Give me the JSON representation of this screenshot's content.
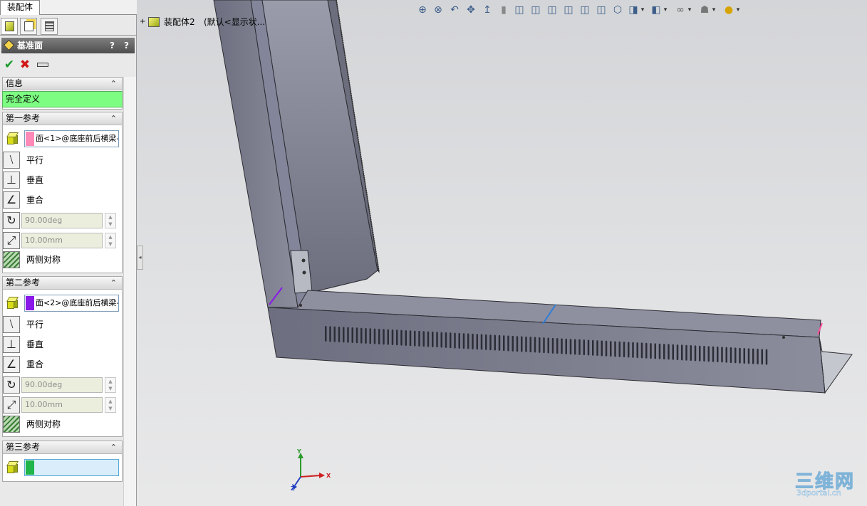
{
  "document_tab": "装配体",
  "property_manager": {
    "title": "基准面",
    "help_labels": [
      "?",
      "?"
    ],
    "ok_symbol": "✔",
    "cancel_symbol": "✖",
    "info": {
      "header": "信息",
      "message": "完全定义",
      "message_color": "#7dfd82"
    },
    "first_reference": {
      "header": "第一参考",
      "selection": "面<1>@底座前后横梁-",
      "swatch_color": "#ff8ab8",
      "options": {
        "parallel": "平行",
        "perpendicular": "垂直",
        "coincident": "重合",
        "symmetric": "两侧对称"
      },
      "angle": "90.00deg",
      "distance": "10.00mm"
    },
    "second_reference": {
      "header": "第二参考",
      "selection": "面<2>@底座前后横梁-",
      "swatch_color": "#8a18e8",
      "options": {
        "parallel": "平行",
        "perpendicular": "垂直",
        "coincident": "重合",
        "symmetric": "两侧对称"
      },
      "angle": "90.00deg",
      "distance": "10.00mm"
    },
    "third_reference": {
      "header": "第三参考",
      "selection": "",
      "swatch_color": "#1fb54a"
    }
  },
  "feature_tree": {
    "expand_symbol": "+",
    "assembly_name": "装配体2",
    "config": "(默认<显示状..."
  },
  "view_toolbar": [
    "zoom-to-fit-icon",
    "zoom-to-area-icon",
    "previous-view-icon",
    "pan-icon",
    "rotate-icon",
    "section-view-icon",
    "front-view-icon",
    "back-view-icon",
    "left-view-icon",
    "right-view-icon",
    "top-view-icon",
    "bottom-view-icon",
    "isometric-view-icon",
    "view-orientation-icon",
    "display-style-icon",
    "hide-show-items-icon",
    "edit-appearance-icon",
    "apply-scene-icon"
  ],
  "triad_labels": {
    "x": "X",
    "y": "Y",
    "z": "Z"
  },
  "watermark": {
    "line1": "三维网",
    "line2": "3dportal.cn"
  },
  "model_color": "#7f8191"
}
